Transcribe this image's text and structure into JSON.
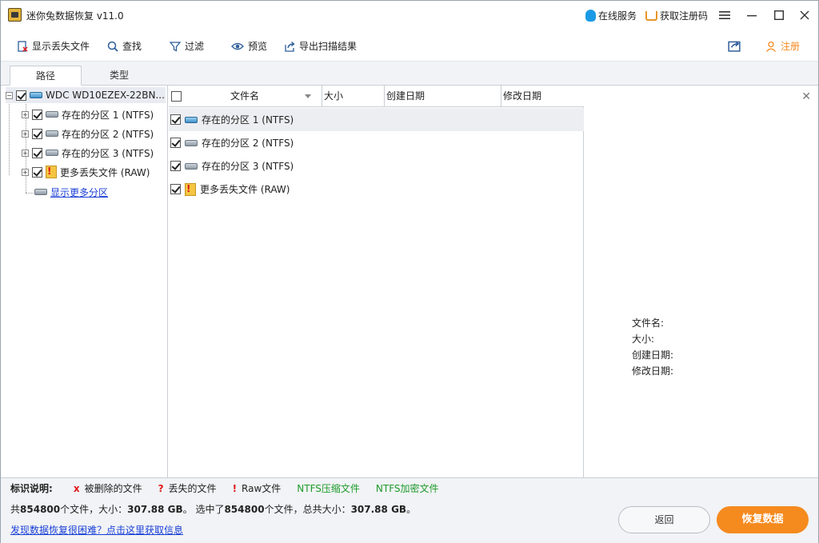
{
  "titlebar": {
    "title": "迷你兔数据恢复 v11.0",
    "online_service": "在线服务",
    "get_code": "获取注册码"
  },
  "toolbar": {
    "show_lost": "显示丢失文件",
    "find": "查找",
    "filter": "过滤",
    "preview": "预览",
    "export": "导出扫描结果",
    "register": "注册"
  },
  "tabs": {
    "path": "路径",
    "type": "类型"
  },
  "tree": {
    "root": "WDC WD10EZEX-22BN...",
    "items": [
      "存在的分区 1 (NTFS)",
      "存在的分区 2 (NTFS)",
      "存在的分区 3 (NTFS)",
      "更多丢失文件 (RAW)"
    ],
    "show_more": "显示更多分区"
  },
  "list": {
    "columns": {
      "name": "文件名",
      "size": "大小",
      "created": "创建日期",
      "modified": "修改日期"
    },
    "rows": [
      "存在的分区 1 (NTFS)",
      "存在的分区 2 (NTFS)",
      "存在的分区 3 (NTFS)",
      "更多丢失文件 (RAW)"
    ]
  },
  "preview": {
    "filename_label": "文件名:",
    "size_label": "大小:",
    "created_label": "创建日期:",
    "modified_label": "修改日期:"
  },
  "legend": {
    "title": "标识说明:",
    "deleted": "被删除的文件",
    "lost": "丢失的文件",
    "raw": "Raw文件",
    "ntfs_compressed": "NTFS压缩文件",
    "ntfs_encrypted": "NTFS加密文件",
    "deleted_mark": "x",
    "lost_mark": "?",
    "raw_mark": "!"
  },
  "summary": {
    "prefix": "共",
    "total_count": "854800",
    "mid1": "个文件，大小：",
    "total_size": "307.88 GB",
    "mid2": "。 选中了",
    "selected_count": "854800",
    "mid3": "个文件，总共大小：",
    "selected_size": "307.88 GB",
    "suffix": "。"
  },
  "help_link": "发现数据恢复很困难？点击这里获取信息",
  "buttons": {
    "back": "返回",
    "recover": "恢复数据"
  },
  "colors": {
    "accent_orange": "#f58a1f",
    "link_blue": "#1a3fd6",
    "ntfs_green": "#1e9a2a",
    "mark_red": "#e01818"
  }
}
